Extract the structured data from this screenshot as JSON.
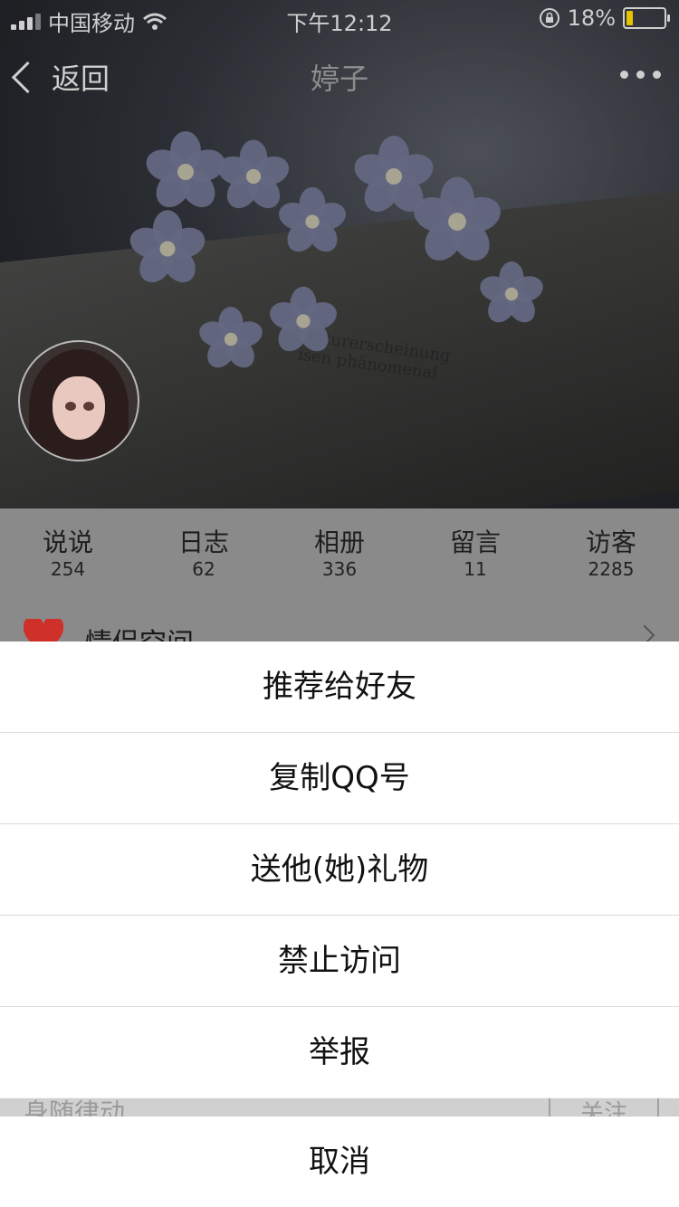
{
  "status_bar": {
    "carrier": "中国移动",
    "time": "下午12:12",
    "battery_percent": "18%",
    "battery_level": 0.18
  },
  "nav": {
    "back_label": "返回",
    "title": "婷子"
  },
  "cover": {
    "book_text": "Naturerscheinung\nisen phänomenal"
  },
  "stats": [
    {
      "label": "说说",
      "value": "254"
    },
    {
      "label": "日志",
      "value": "62"
    },
    {
      "label": "相册",
      "value": "336"
    },
    {
      "label": "留言",
      "value": "11"
    },
    {
      "label": "访客",
      "value": "2285"
    }
  ],
  "peek_row": {
    "label": "情侣空间"
  },
  "background_peek": {
    "label": "身随律动",
    "button": "关注"
  },
  "action_sheet": {
    "items": [
      "推荐给好友",
      "复制QQ号",
      "送他(她)礼物",
      "禁止访问",
      "举报"
    ],
    "cancel": "取消"
  },
  "colors": {
    "accent_heart": "#d0302a",
    "battery_fill": "#e8c400"
  }
}
